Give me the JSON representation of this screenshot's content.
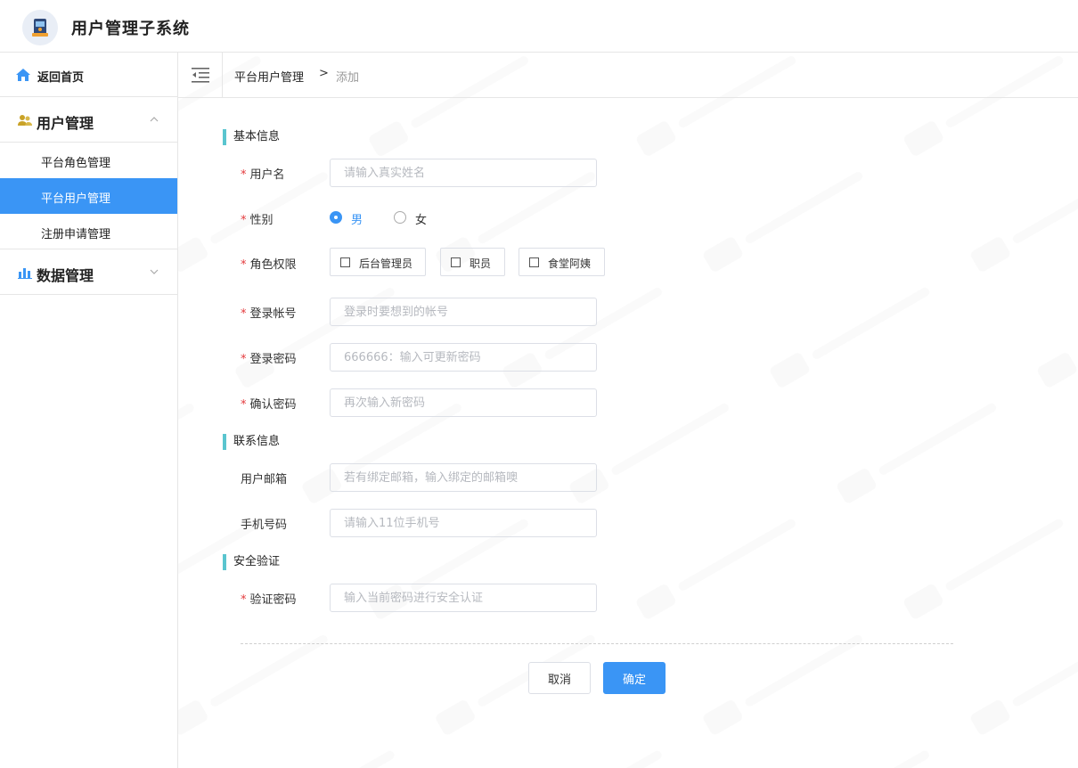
{
  "app": {
    "title": "用户管理子系统"
  },
  "sidebar": {
    "home_label": "返回首页",
    "groups": [
      {
        "label": "用户管理",
        "expanded": true,
        "items": [
          {
            "label": "平台角色管理",
            "active": false
          },
          {
            "label": "平台用户管理",
            "active": true
          },
          {
            "label": "注册申请管理",
            "active": false
          }
        ]
      },
      {
        "label": "数据管理",
        "expanded": false,
        "items": []
      }
    ]
  },
  "breadcrumb": {
    "parent": "平台用户管理",
    "separator": ">",
    "current": "添加"
  },
  "form": {
    "sections": {
      "basic": "基本信息",
      "contact": "联系信息",
      "security": "安全验证"
    },
    "required_mark": "*",
    "username": {
      "label": "用户名",
      "placeholder": "请输入真实姓名",
      "value": ""
    },
    "gender": {
      "label": "性别",
      "options": [
        "男",
        "女"
      ],
      "selected": "男"
    },
    "roles": {
      "label": "角色权限",
      "options": [
        "后台管理员",
        "职员",
        "食堂阿姨"
      ],
      "checked": []
    },
    "account": {
      "label": "登录帐号",
      "placeholder": "登录时要想到的帐号",
      "value": ""
    },
    "password": {
      "label": "登录密码",
      "placeholder": "666666：输入可更新密码",
      "value": ""
    },
    "confirm_password": {
      "label": "确认密码",
      "placeholder": "再次输入新密码",
      "value": ""
    },
    "email": {
      "label": "用户邮箱",
      "placeholder": "若有绑定邮箱，输入绑定的邮箱噢",
      "value": ""
    },
    "phone": {
      "label": "手机号码",
      "placeholder": "请输入11位手机号",
      "value": ""
    },
    "verify_password": {
      "label": "验证密码",
      "placeholder": "输入当前密码进行安全认证",
      "value": ""
    },
    "cancel_label": "取消",
    "confirm_label": "确定"
  },
  "colors": {
    "accent": "#3a95f5",
    "section_bar": "#5ac5cf",
    "required": "#e4393c"
  }
}
